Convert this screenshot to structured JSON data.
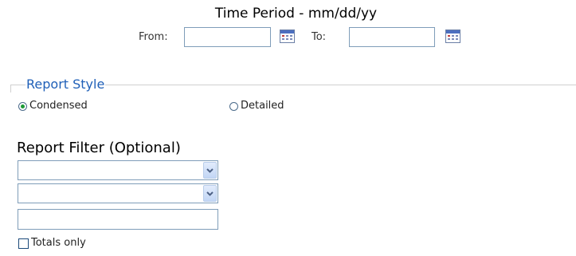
{
  "time_period": {
    "title": "Time Period - mm/dd/yy",
    "from_label": "From:",
    "from_value": "",
    "to_label": "To:",
    "to_value": "",
    "calendar_icon": "calendar-icon"
  },
  "report_style": {
    "legend": "Report Style",
    "options": [
      {
        "label": "Condensed",
        "selected": true
      },
      {
        "label": "Detailed",
        "selected": false
      }
    ]
  },
  "report_filter": {
    "title": "Report Filter (Optional)",
    "select_1_value": "",
    "select_2_value": "",
    "text_value": "",
    "totals_only_label": "Totals only",
    "totals_only_checked": false
  },
  "colors": {
    "legend": "#2060b8",
    "border": "#7f9db9",
    "radio_selected": "#1c9a36"
  }
}
